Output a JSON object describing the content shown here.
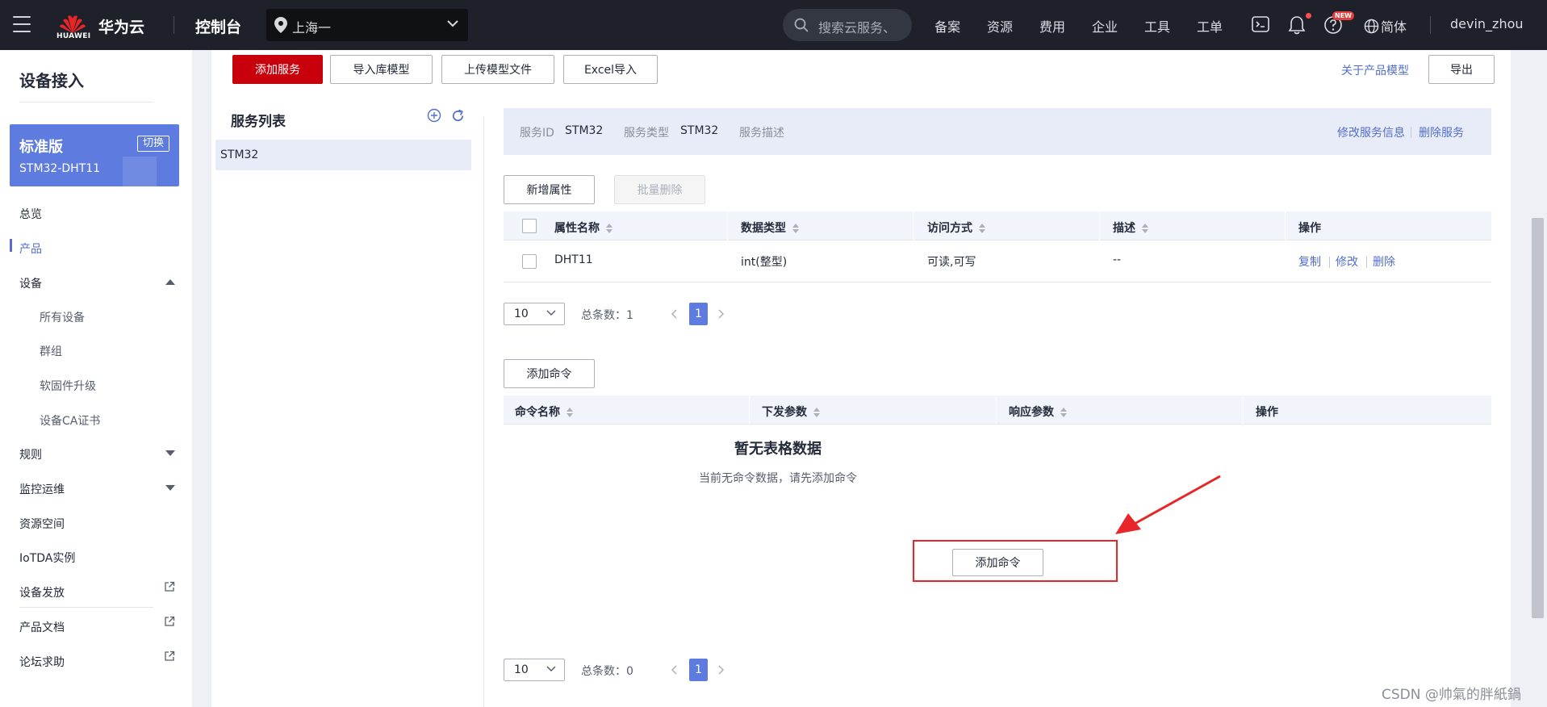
{
  "topbar": {
    "logo_text": "HUAWEI",
    "brand": "华为云",
    "console": "控制台",
    "region": "上海一",
    "search_placeholder": "搜索云服务、",
    "nav": [
      "备案",
      "资源",
      "费用",
      "企业",
      "工具",
      "工单"
    ],
    "new_badge": "NEW",
    "language": "简体",
    "user": "devin_zhou"
  },
  "sidebar": {
    "title": "设备接入",
    "edition": {
      "name": "标准版",
      "switch": "切换",
      "product": "STM32-DHT11"
    },
    "items": {
      "overview": "总览",
      "products": "产品",
      "devices": "设备",
      "all_devices": "所有设备",
      "groups": "群组",
      "firmware": "软固件升级",
      "device_ca": "设备CA证书",
      "rules": "规则",
      "monitoring": "监控运维",
      "resource_space": "资源空间",
      "iotda": "IoTDA实例",
      "provisioning": "设备发放",
      "docs": "产品文档",
      "forum": "论坛求助"
    }
  },
  "toolbar": {
    "add_service": "添加服务",
    "import_model": "导入库模型",
    "upload_model": "上传模型文件",
    "excel_import": "Excel导入",
    "about_model": "关于产品模型",
    "export": "导出"
  },
  "service_list": {
    "title": "服务列表",
    "items": [
      "STM32"
    ]
  },
  "service_info": {
    "id_label": "服务ID",
    "id_value": "STM32",
    "type_label": "服务类型",
    "type_value": "STM32",
    "desc_label": "服务描述",
    "modify": "修改服务信息",
    "delete": "删除服务"
  },
  "properties": {
    "add_button": "新增属性",
    "batch_delete": "批量删除",
    "columns": [
      "属性名称",
      "数据类型",
      "访问方式",
      "描述",
      "操作"
    ],
    "rows": [
      {
        "name": "DHT11",
        "type": "int(整型)",
        "access": "可读,可写",
        "desc": "--"
      }
    ],
    "ops": [
      "复制",
      "修改",
      "删除"
    ],
    "pager": {
      "size": "10",
      "total_label": "总条数：1",
      "current": "1"
    }
  },
  "commands": {
    "add_button": "添加命令",
    "columns": [
      "命令名称",
      "下发参数",
      "响应参数",
      "操作"
    ],
    "empty_title": "暂无表格数据",
    "empty_desc": "当前无命令数据，请先添加命令",
    "empty_add": "添加命令",
    "pager": {
      "size": "10",
      "total_label": "总条数：0",
      "current": "1"
    }
  },
  "colors": {
    "topbar": "#1e2129",
    "primary_red": "#c7000b",
    "accent_blue": "#5e7ce0",
    "link": "#526ecc",
    "highlight": "#e8262a"
  },
  "watermark": "CSDN @帅氣的胖紙鍋"
}
